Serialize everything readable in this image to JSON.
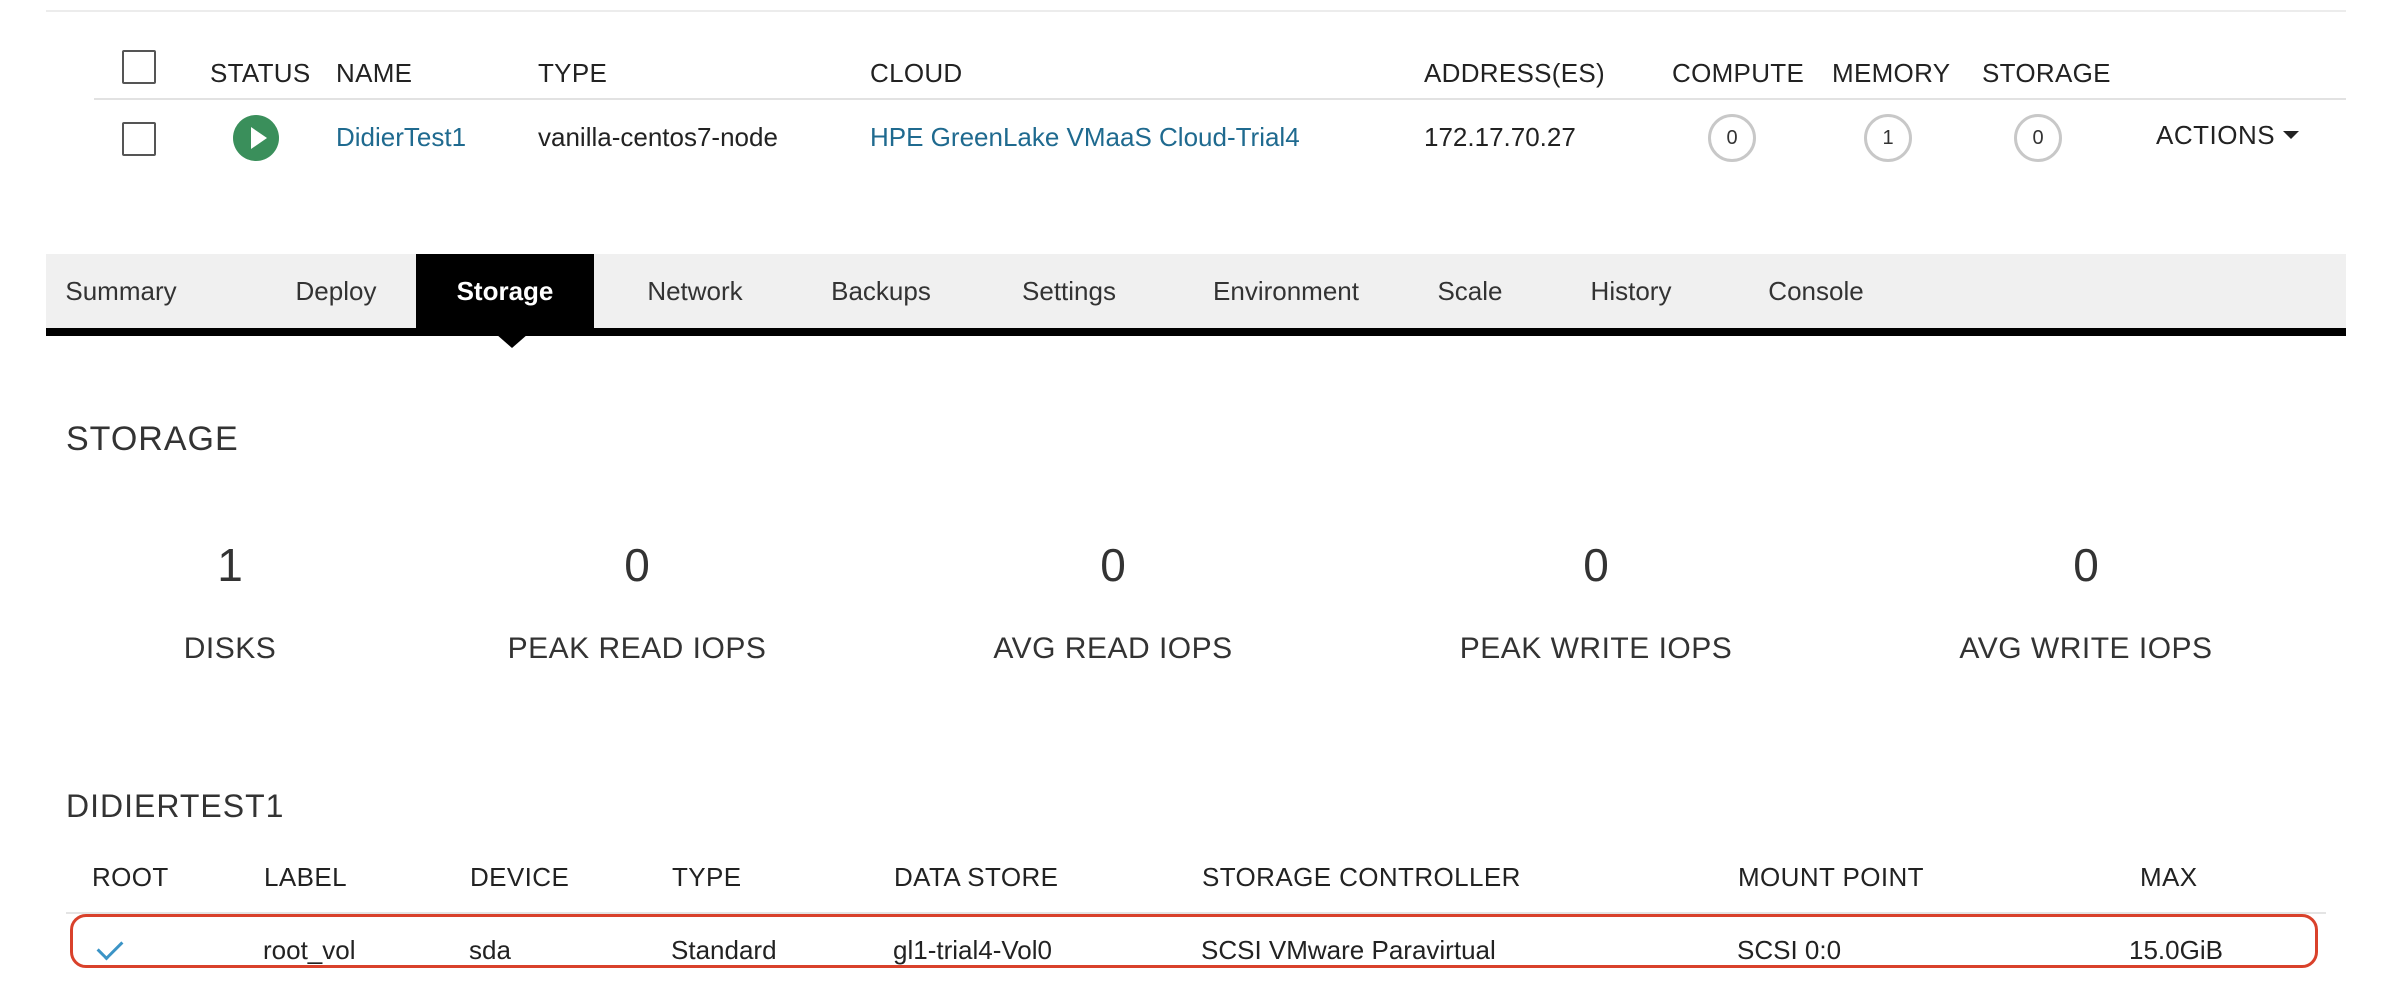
{
  "instance_table": {
    "headers": {
      "status": "STATUS",
      "name": "NAME",
      "type": "TYPE",
      "cloud": "CLOUD",
      "addresses": "ADDRESS(ES)",
      "compute": "COMPUTE",
      "memory": "MEMORY",
      "storage": "STORAGE"
    },
    "row": {
      "status": "running",
      "name": "DidierTest1",
      "type": "vanilla-centos7-node",
      "cloud": "HPE GreenLake VMaaS Cloud-Trial4",
      "address": "172.17.70.27",
      "compute": "0",
      "memory": "1",
      "storage": "0",
      "actions_label": "ACTIONS"
    }
  },
  "tabs": [
    {
      "label": "Summary"
    },
    {
      "label": "Deploy"
    },
    {
      "label": "Storage",
      "active": true
    },
    {
      "label": "Network"
    },
    {
      "label": "Backups"
    },
    {
      "label": "Settings"
    },
    {
      "label": "Environment"
    },
    {
      "label": "Scale"
    },
    {
      "label": "History"
    },
    {
      "label": "Console"
    }
  ],
  "storage_section": {
    "title": "STORAGE",
    "stats": [
      {
        "value": "1",
        "label": "DISKS"
      },
      {
        "value": "0",
        "label": "PEAK READ IOPS"
      },
      {
        "value": "0",
        "label": "AVG READ IOPS"
      },
      {
        "value": "0",
        "label": "PEAK WRITE IOPS"
      },
      {
        "value": "0",
        "label": "AVG WRITE IOPS"
      }
    ]
  },
  "disk_section": {
    "title": "DIDIERTEST1",
    "headers": {
      "root": "ROOT",
      "label": "LABEL",
      "device": "DEVICE",
      "type": "TYPE",
      "data_store": "DATA STORE",
      "storage_controller": "STORAGE CONTROLLER",
      "mount_point": "MOUNT POINT",
      "max": "MAX"
    },
    "rows": [
      {
        "root": true,
        "label": "root_vol",
        "device": "sda",
        "type": "Standard",
        "data_store": "gl1-trial4-Vol0",
        "storage_controller": "SCSI VMware Paravirtual",
        "mount_point": "SCSI 0:0",
        "max": "15.0GiB"
      }
    ]
  },
  "colors": {
    "link": "#1f6a8f",
    "status_running": "#3a8f5b",
    "active_tab_bg": "#000000",
    "highlight_border": "#d9412b",
    "check": "#3b94c6"
  }
}
